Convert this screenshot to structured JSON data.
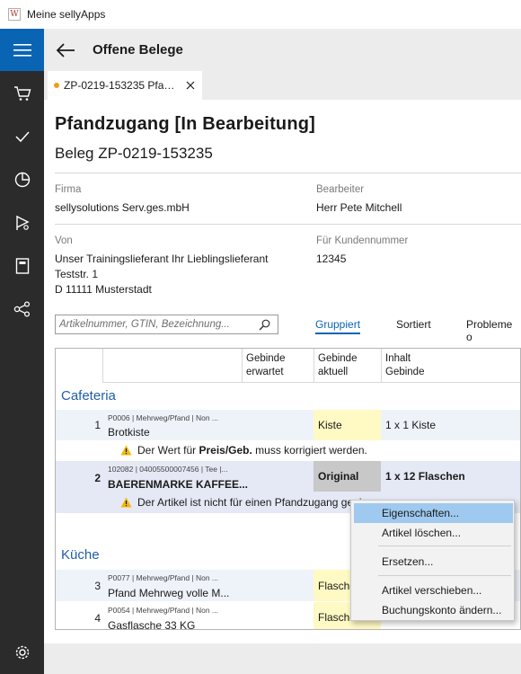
{
  "window": {
    "title": "Meine sellyApps",
    "app_icon_glyph": "W"
  },
  "header": {
    "title": "Offene Belege"
  },
  "tab": {
    "label": "ZP-0219-153235 Pfa…",
    "status_color": "#f29b1d"
  },
  "doc": {
    "title": "Pfandzugang [In Bearbeitung]",
    "subtitle": "Beleg ZP-0219-153235",
    "firma_label": "Firma",
    "firma_value": "sellysolutions Serv.ges.mbH",
    "bearbeiter_label": "Bearbeiter",
    "bearbeiter_value": "Herr Pete Mitchell",
    "von_label": "Von",
    "von_line1": "Unser Trainingslieferant Ihr Lieblingslieferant",
    "von_line2": "Teststr. 1",
    "von_line3": "D 11111 Musterstadt",
    "kunden_label": "Für Kundennummer",
    "kunden_value": "12345"
  },
  "toolbar": {
    "search_placeholder": "Artikelnummer, GTIN, Bezeichnung...",
    "grouped": "Gruppiert",
    "sorted": "Sortiert",
    "problems": "Probleme o"
  },
  "grid": {
    "col_gebinde_erwartet_1": "Gebinde",
    "col_gebinde_erwartet_2": "erwartet",
    "col_gebinde_aktuell_1": "Gebinde",
    "col_gebinde_aktuell_2": "aktuell",
    "col_inhalt_1": "Inhalt",
    "col_inhalt_2": "Gebinde",
    "group_cafeteria": "Cafeteria",
    "group_kueche": "Küche",
    "rows": [
      {
        "num": "1",
        "meta": "P0006 | Mehrweg/Pfand | Non ...",
        "name": "Brotkiste",
        "aktuell": "Kiste",
        "inhalt": "1 x 1 Kiste",
        "warning_pre": "Der Wert für ",
        "warning_bold": "Preis/Geb.",
        "warning_post": " muss korrigiert werden."
      },
      {
        "num": "2",
        "meta": "102082 | 04005500007456 | Tee |...",
        "name": "BAERENMARKE KAFFEE...",
        "aktuell": "Original",
        "inhalt": "1 x 12 Flaschen",
        "warning": "Der Artikel ist nicht für einen Pfandzugang geei"
      },
      {
        "num": "3",
        "meta": "P0077 | Mehrweg/Pfand | Non ...",
        "name": "Pfand Mehrweg volle M...",
        "aktuell": "Flasche"
      },
      {
        "num": "4",
        "meta": "P0054 | Mehrweg/Pfand | Non ...",
        "name": "Gasflasche 33 KG",
        "aktuell": "Flasche"
      }
    ]
  },
  "context_menu": {
    "items": [
      "Eigenschaften...",
      "Artikel löschen...",
      "Ersetzen...",
      "Artikel verschieben...",
      "Buchungskonto ändern..."
    ]
  },
  "colors": {
    "accent": "#0a64b4",
    "sidebar": "#2b2b2b",
    "group_text": "#1f5ea8",
    "highlight_yellow": "#fff9c4",
    "menu_highlight": "#9fc9ef",
    "warning": "#f2b705"
  },
  "icons": [
    "hamburger-menu-icon",
    "cart-icon",
    "checkmark-icon",
    "pie-chart-icon",
    "route-icon",
    "book-icon",
    "share-icon",
    "settings-gear-icon",
    "back-arrow-icon",
    "close-icon",
    "search-icon",
    "warning-icon"
  ]
}
